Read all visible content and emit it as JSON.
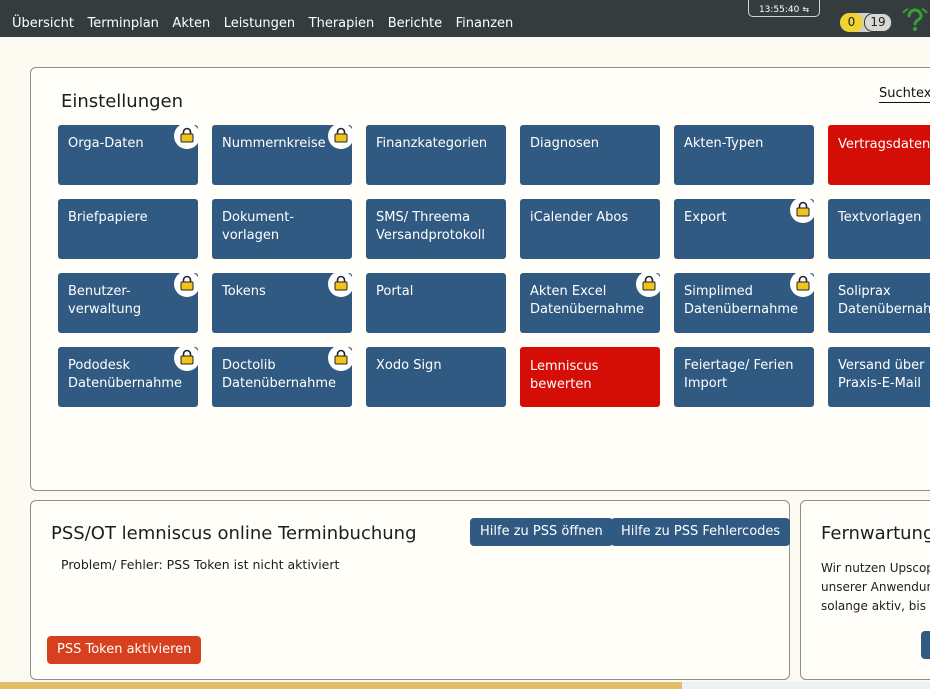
{
  "nav": {
    "items": [
      "Übersicht",
      "Terminplan",
      "Akten",
      "Leistungen",
      "Therapien",
      "Berichte",
      "Finanzen"
    ]
  },
  "status": {
    "time": "13:55:40",
    "sync_icon": "sync-icon",
    "count_yellow": "0",
    "count_grey": "19",
    "help_icon": "question-wifi-icon",
    "help_color": "#3aa13a"
  },
  "settings": {
    "title": "Einstellungen",
    "search_label": "Suchtext",
    "tiles": [
      {
        "label": "Orga-Daten",
        "locked": true,
        "red": false
      },
      {
        "label": "Nummernkreise",
        "locked": true,
        "red": false
      },
      {
        "label": "Finanzkategorien",
        "locked": false,
        "red": false
      },
      {
        "label": "Diagnosen",
        "locked": false,
        "red": false
      },
      {
        "label": "Akten-Typen",
        "locked": false,
        "red": false
      },
      {
        "label": "Vertragsdaten",
        "locked": false,
        "red": true
      },
      {
        "label": "Briefpapiere",
        "locked": false,
        "red": false
      },
      {
        "label": "Dokument-\nvorlagen",
        "locked": false,
        "red": false
      },
      {
        "label": "SMS/ Threema\nVersandprotokoll",
        "locked": false,
        "red": false
      },
      {
        "label": "iCalender Abos",
        "locked": false,
        "red": false
      },
      {
        "label": "Export",
        "locked": true,
        "red": false
      },
      {
        "label": "Textvorlagen",
        "locked": false,
        "red": false
      },
      {
        "label": "Benutzer-\nverwaltung",
        "locked": true,
        "red": false
      },
      {
        "label": "Tokens",
        "locked": true,
        "red": false
      },
      {
        "label": "Portal",
        "locked": false,
        "red": false
      },
      {
        "label": "Akten Excel\nDatenübernahme",
        "locked": true,
        "red": false
      },
      {
        "label": "Simplimed\nDatenübernahme",
        "locked": true,
        "red": false
      },
      {
        "label": "Soliprax\nDatenübernahme",
        "locked": false,
        "red": false
      },
      {
        "label": "Pododesk\nDatenübernahme",
        "locked": true,
        "red": false
      },
      {
        "label": "Doctolib\nDatenübernahme",
        "locked": true,
        "red": false
      },
      {
        "label": "Xodo Sign",
        "locked": false,
        "red": false
      },
      {
        "label": "Lemniscus\nbewerten",
        "locked": false,
        "red": true
      },
      {
        "label": "Feiertage/ Ferien\nImport",
        "locked": false,
        "red": false
      },
      {
        "label": "Versand über\nPraxis-E-Mail",
        "locked": false,
        "red": false
      }
    ]
  },
  "pss": {
    "title": "PSS/OT lemniscus online Terminbuchung",
    "help_button": "Hilfe zu PSS öffnen",
    "errors_button": "Hilfe zu PSS Fehlercodes",
    "status_text": "Problem/ Fehler: PSS Token ist nicht aktiviert",
    "activate_button": "PSS Token aktivieren"
  },
  "remote": {
    "title": "Fernwartung",
    "lines": [
      "Wir nutzen Upscop",
      "unserer Anwendun",
      "solange aktiv, bis d"
    ]
  },
  "colors": {
    "topbar": "#353c3d",
    "tile_blue": "#315a82",
    "tile_red": "#d40e06",
    "background": "#fdfbf1"
  }
}
